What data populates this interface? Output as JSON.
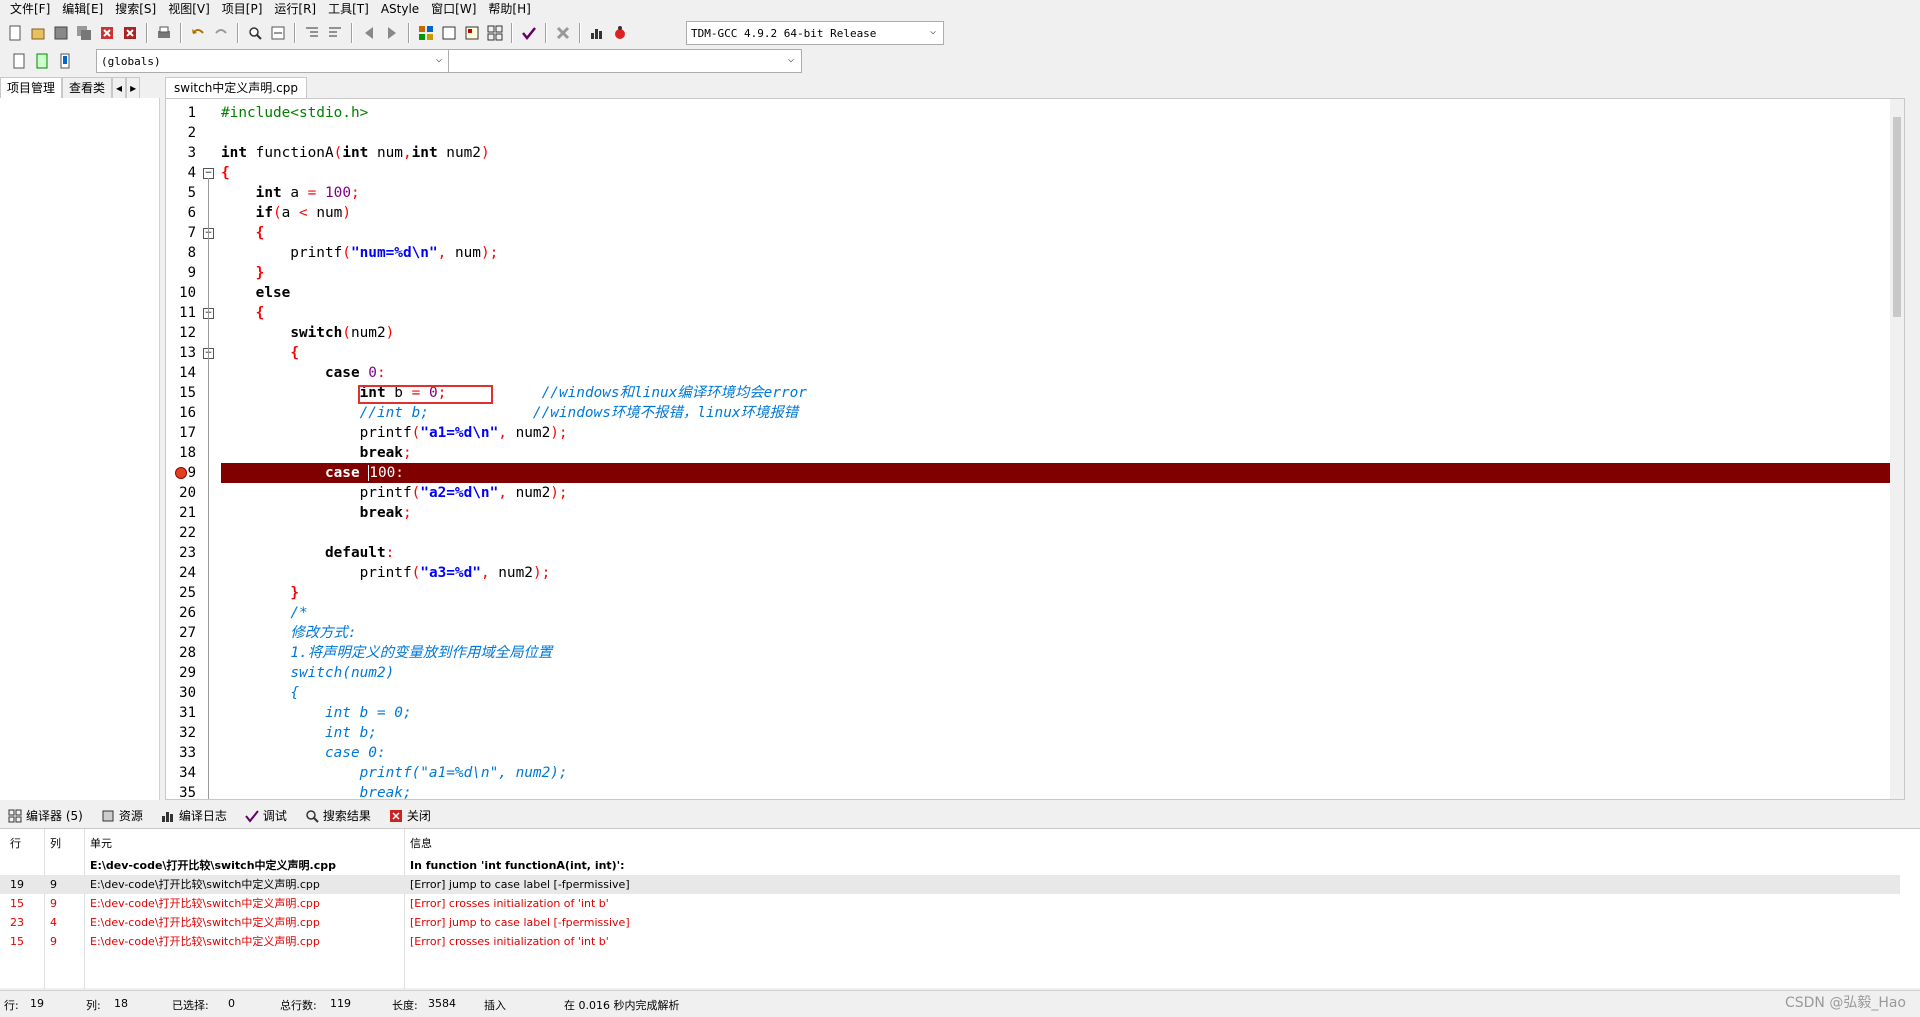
{
  "menu": [
    "文件[F]",
    "编辑[E]",
    "搜索[S]",
    "视图[V]",
    "项目[P]",
    "运行[R]",
    "工具[T]",
    "AStyle",
    "窗口[W]",
    "帮助[H]"
  ],
  "toolbar": {
    "compiler_select": "TDM-GCC 4.9.2 64-bit Release",
    "scope_select": "(globals)",
    "symbol_select": ""
  },
  "left_tabs": [
    "项目管理",
    "查看类"
  ],
  "editor": {
    "file_tab": "switch中定义声明.cpp",
    "line_count": 35,
    "error_line": 19,
    "folds": [
      4,
      7,
      11,
      13
    ],
    "fold_ends": [
      9,
      25
    ]
  },
  "bottom_tabs": [
    "编译器 (5)",
    "资源",
    "编译日志",
    "调试",
    "搜索结果",
    "关闭"
  ],
  "messages": {
    "headers": [
      "行",
      "列",
      "单元",
      "信息"
    ],
    "rows": [
      {
        "line": "",
        "col": "",
        "unit": "E:\\dev-code\\打开比较\\switch中定义声明.cpp",
        "info": "In function 'int functionA(int, int)':",
        "style": "bold"
      },
      {
        "line": "19",
        "col": "9",
        "unit": "E:\\dev-code\\打开比较\\switch中定义声明.cpp",
        "info": "[Error] jump to case label [-fpermissive]",
        "style": "sel"
      },
      {
        "line": "15",
        "col": "9",
        "unit": "E:\\dev-code\\打开比较\\switch中定义声明.cpp",
        "info": "[Error] crosses initialization of 'int b'",
        "style": "red"
      },
      {
        "line": "23",
        "col": "4",
        "unit": "E:\\dev-code\\打开比较\\switch中定义声明.cpp",
        "info": "[Error] jump to case label [-fpermissive]",
        "style": "red"
      },
      {
        "line": "15",
        "col": "9",
        "unit": "E:\\dev-code\\打开比较\\switch中定义声明.cpp",
        "info": "[Error] crosses initialization of 'int b'",
        "style": "red"
      }
    ]
  },
  "status": {
    "line_label": "行:",
    "line_value": "19",
    "col_label": "列:",
    "col_value": "18",
    "sel_label": "已选择:",
    "sel_value": "0",
    "total_label": "总行数:",
    "total_value": "119",
    "len_label": "长度:",
    "len_value": "3584",
    "mode": "插入",
    "parse_msg": "在 0.016 秒内完成解析"
  },
  "watermark": "CSDN @弘毅_Hao",
  "colors": {
    "error_line": "#800000",
    "comment": "#0078d7",
    "string": "#0000ff",
    "number": "#800080",
    "highlight_box": "#e03030"
  }
}
